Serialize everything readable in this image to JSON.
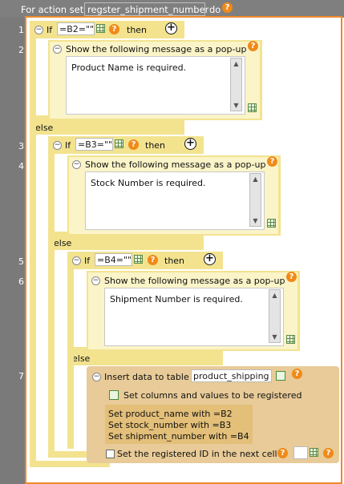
{
  "header": {
    "prefix": "For action set",
    "action_set_name": "regster_shipment_number",
    "suffix": "do"
  },
  "line_numbers": [
    "1",
    "2",
    "3",
    "4",
    "5",
    "6",
    "7"
  ],
  "blocks": {
    "if1": {
      "if_label": "If",
      "condition": "=B2=\"\"",
      "then_label": "then"
    },
    "popup1": {
      "title": "Show the following message as a pop-up",
      "message": "Product Name is required."
    },
    "else1": "else",
    "if2": {
      "if_label": "If",
      "condition": "=B3=\"\"",
      "then_label": "then"
    },
    "popup2": {
      "title": "Show the following message as a pop-up",
      "message": "Stock Number is required."
    },
    "else2": "else",
    "if3": {
      "if_label": "If",
      "condition": "=B4=\"\"",
      "then_label": "then"
    },
    "popup3": {
      "title": "Show the following message as a pop-up",
      "message": "Shipment Number is required."
    },
    "else3": "else",
    "insert": {
      "title": "Insert data to table",
      "table_name": "product_shipping",
      "set_columns_label": "Set columns and values to be registered",
      "set_lines": [
        "Set product_name with =B2",
        "Set stock_number with =B3",
        "Set shipment_number with =B4"
      ],
      "registered_id_label": "Set the registered ID in the next cell",
      "registered_id_value": ""
    }
  },
  "icons": {
    "help": "?",
    "minus": "−",
    "plus": "+",
    "scroll_up": "▲",
    "scroll_down": "▼"
  },
  "colors": {
    "orange_frame": "#ef8a2a",
    "yellow_block": "#f3e38f",
    "gray_gutter": "#7a7a7a",
    "peach_block": "#e8cb98"
  }
}
